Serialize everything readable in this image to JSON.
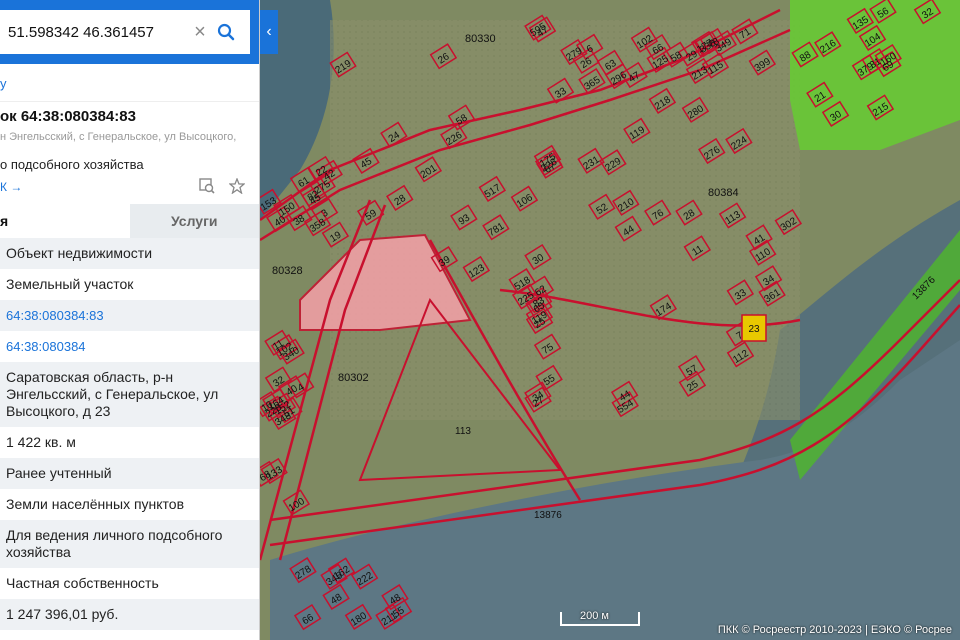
{
  "search": {
    "value": "51.598342 46.361457"
  },
  "panel": {
    "back_label": "у",
    "title": "ок 64:38:080384:83",
    "subtitle": "н Энгельсский, с Генеральское, ул Высоцкого,",
    "type_line": "о подсобного хозяйства",
    "short_link": "К →",
    "tabs": [
      {
        "label": "я"
      },
      {
        "label": "Услуги"
      }
    ],
    "rows": [
      "Объект недвижимости",
      "Земельный участок",
      "64:38:080384:83",
      "64:38:080384",
      "Саратовская область, р-н Энгельсский, с Генеральское, ул Высоцкого, д 23",
      "1 422 кв. м",
      "Ранее учтенный",
      "Земли населённых пунктов",
      "Для ведения личного подсобного хозяйства",
      "Частная собственность",
      "1 247 396,01 руб."
    ]
  },
  "map": {
    "quarters": [
      "80330",
      "80384",
      "80328",
      "80302"
    ],
    "road_labels": [
      "13876",
      "13876"
    ],
    "parcel_labels": [
      "33",
      "201",
      "44",
      "34",
      "160",
      "38",
      "340",
      "222",
      "338",
      "365",
      "226",
      "361",
      "75",
      "35",
      "45",
      "40",
      "64",
      "66",
      "26",
      "39",
      "52",
      "27",
      "30",
      "22",
      "51",
      "55",
      "6",
      "47",
      "28",
      "11",
      "7",
      "379",
      "358",
      "348",
      "345",
      "349",
      "58",
      "33",
      "34",
      "57",
      "56",
      "61",
      "228",
      "211",
      "296",
      "219",
      "210",
      "225",
      "44",
      "69",
      "40",
      "4",
      "278",
      "115",
      "119",
      "123",
      "228",
      "83",
      "215",
      "45",
      "102",
      "48",
      "279",
      "26",
      "276",
      "175",
      "174",
      "135",
      "275",
      "68",
      "180",
      "47",
      "218",
      "517",
      "518",
      "65",
      "216",
      "153",
      "152",
      "26",
      "58",
      "24",
      "76",
      "110",
      "554",
      "50",
      "3",
      "100",
      "107",
      "213",
      "595",
      "302",
      "28",
      "25",
      "31",
      "59",
      "10",
      "28",
      "177",
      "102",
      "93",
      "231",
      "112",
      "88",
      "150",
      "133",
      "102",
      "29",
      "78",
      "106",
      "41",
      "119",
      "104",
      "82",
      "11",
      "66",
      "125",
      "71",
      "67",
      "229",
      "55",
      "32",
      "42",
      "32",
      "48",
      "63",
      "224",
      "62",
      "113",
      "25",
      "21",
      "19",
      "164",
      "162",
      "399",
      "280",
      "781",
      "30"
    ],
    "highlight_label": "23",
    "scale": "200 м",
    "attribution": "ПКК © Росреестр 2010-2023 | ЕЭКО © Росрее"
  },
  "colors": {
    "accent": "#1a73d9",
    "parcel_line": "#c8102e",
    "selected_fill": "#f5a0a8",
    "highlight_fill": "#e8c800",
    "zone_green": "#66cc33"
  }
}
